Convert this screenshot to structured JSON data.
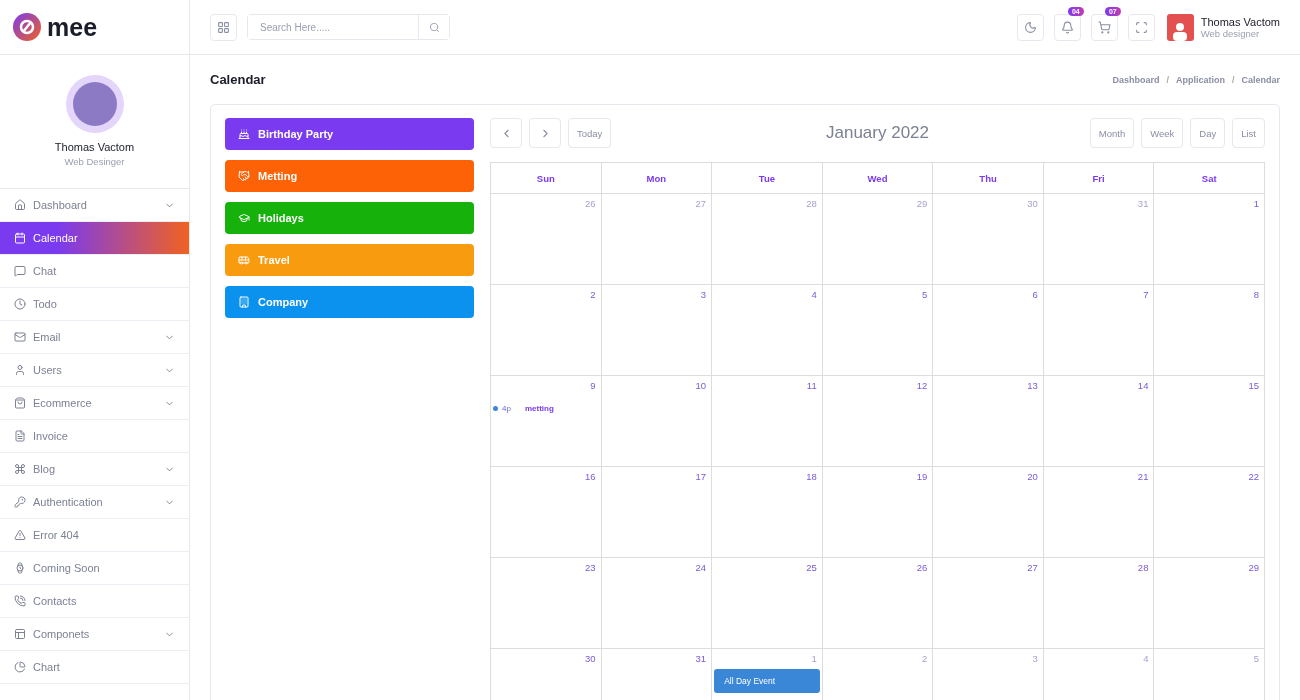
{
  "brand": {
    "name": "mee"
  },
  "header": {
    "search": {
      "placeholder": "Search Here....."
    },
    "notifications": {
      "badge": "04"
    },
    "cart": {
      "badge": "07"
    },
    "user": {
      "name": "Thomas Vactom",
      "role": "Web designer"
    }
  },
  "sidebar": {
    "profile": {
      "name": "Thomas Vactom",
      "role": "Web Desinger"
    },
    "items": [
      {
        "label": "Dashboard",
        "selected": false,
        "expandable": true
      },
      {
        "label": "Calendar",
        "selected": true,
        "expandable": false
      },
      {
        "label": "Chat",
        "selected": false,
        "expandable": false
      },
      {
        "label": "Todo",
        "selected": false,
        "expandable": false
      },
      {
        "label": "Email",
        "selected": false,
        "expandable": true
      },
      {
        "label": "Users",
        "selected": false,
        "expandable": true
      },
      {
        "label": "Ecommerce",
        "selected": false,
        "expandable": true
      },
      {
        "label": "Invoice",
        "selected": false,
        "expandable": false
      },
      {
        "label": "Blog",
        "selected": false,
        "expandable": true
      },
      {
        "label": "Authentication",
        "selected": false,
        "expandable": true
      },
      {
        "label": "Error 404",
        "selected": false,
        "expandable": false
      },
      {
        "label": "Coming Soon",
        "selected": false,
        "expandable": false
      },
      {
        "label": "Contacts",
        "selected": false,
        "expandable": false
      },
      {
        "label": "Componets",
        "selected": false,
        "expandable": true
      },
      {
        "label": "Chart",
        "selected": false,
        "expandable": false
      }
    ]
  },
  "page_title": "Calendar",
  "breadcrumb": {
    "separator": "/",
    "items": [
      "Dashboard",
      "Application",
      "Calendar"
    ]
  },
  "categories": [
    {
      "label": "Birthday Party",
      "color": "#7a3af0"
    },
    {
      "label": "Metting",
      "color": "#fd6207"
    },
    {
      "label": "Holidays",
      "color": "#16b20b"
    },
    {
      "label": "Travel",
      "color": "#f99b0e"
    },
    {
      "label": "Company",
      "color": "#0b92ee"
    }
  ],
  "calendar": {
    "title": "January 2022",
    "today_button": "Today",
    "views": [
      "Month",
      "Week",
      "Day",
      "List"
    ],
    "weekdays": [
      "Sun",
      "Mon",
      "Tue",
      "Wed",
      "Thu",
      "Fri",
      "Sat"
    ],
    "weeks": [
      [
        {
          "day": "26",
          "other_month": true
        },
        {
          "day": "27",
          "other_month": true
        },
        {
          "day": "28",
          "other_month": true
        },
        {
          "day": "29",
          "other_month": true
        },
        {
          "day": "30",
          "other_month": true
        },
        {
          "day": "31",
          "other_month": true
        },
        {
          "day": "1",
          "other_month": false
        }
      ],
      [
        {
          "day": "2",
          "other_month": false
        },
        {
          "day": "3",
          "other_month": false
        },
        {
          "day": "4",
          "other_month": false
        },
        {
          "day": "5",
          "other_month": false
        },
        {
          "day": "6",
          "other_month": false
        },
        {
          "day": "7",
          "other_month": false
        },
        {
          "day": "8",
          "other_month": false
        }
      ],
      [
        {
          "day": "9",
          "other_month": false,
          "events": [
            {
              "kind": "dot",
              "time": "4p",
              "title": "metting",
              "color": "#3a87d8"
            }
          ]
        },
        {
          "day": "10",
          "other_month": false
        },
        {
          "day": "11",
          "other_month": false
        },
        {
          "day": "12",
          "other_month": false
        },
        {
          "day": "13",
          "other_month": false
        },
        {
          "day": "14",
          "other_month": false
        },
        {
          "day": "15",
          "other_month": false
        }
      ],
      [
        {
          "day": "16",
          "other_month": false
        },
        {
          "day": "17",
          "other_month": false
        },
        {
          "day": "18",
          "other_month": false
        },
        {
          "day": "19",
          "other_month": false
        },
        {
          "day": "20",
          "other_month": false
        },
        {
          "day": "21",
          "other_month": false
        },
        {
          "day": "22",
          "other_month": false
        }
      ],
      [
        {
          "day": "23",
          "other_month": false
        },
        {
          "day": "24",
          "other_month": false
        },
        {
          "day": "25",
          "other_month": false
        },
        {
          "day": "26",
          "other_month": false
        },
        {
          "day": "27",
          "other_month": false
        },
        {
          "day": "28",
          "other_month": false
        },
        {
          "day": "29",
          "other_month": false
        }
      ],
      [
        {
          "day": "30",
          "other_month": false
        },
        {
          "day": "31",
          "other_month": false
        },
        {
          "day": "1",
          "other_month": true,
          "events": [
            {
              "kind": "block",
              "title": "All Day Event",
              "color": "#3a87d8"
            }
          ]
        },
        {
          "day": "2",
          "other_month": true
        },
        {
          "day": "3",
          "other_month": true
        },
        {
          "day": "4",
          "other_month": true
        },
        {
          "day": "5",
          "other_month": true
        }
      ]
    ]
  }
}
